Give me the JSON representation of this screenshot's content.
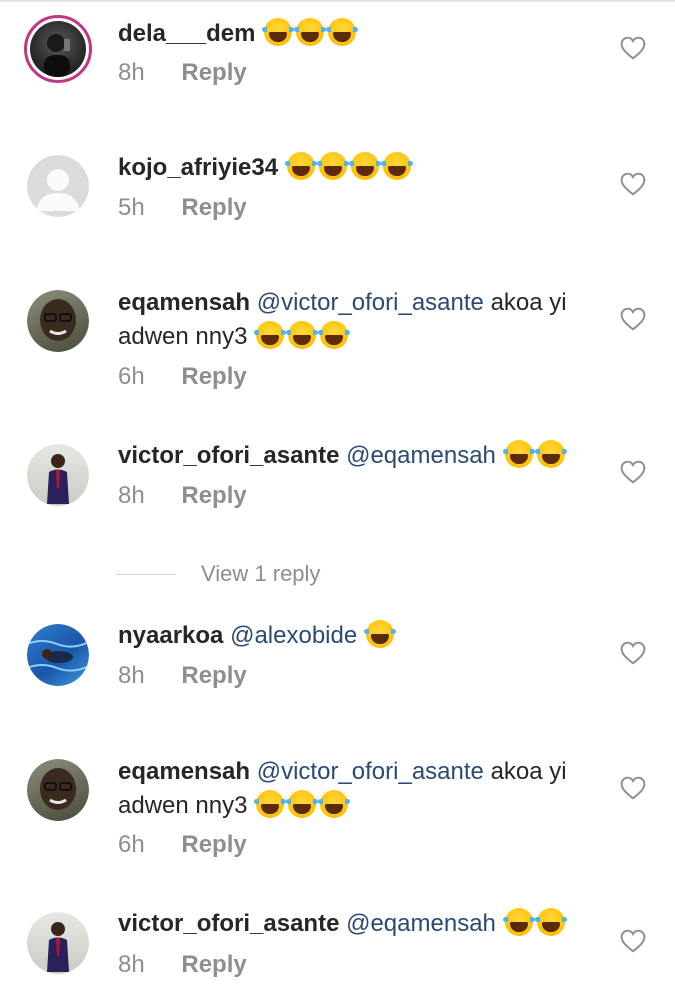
{
  "comments": [
    {
      "username": "dela___dem",
      "text": "",
      "time": "8h",
      "reply": "Reply",
      "emoji_count": 3,
      "avatar": "dark-selfie-avatar"
    },
    {
      "username": "kojo_afriyie34",
      "text": "",
      "time": "5h",
      "reply": "Reply",
      "emoji_count": 4,
      "avatar": "default-avatar"
    },
    {
      "username": "eqamensah",
      "mention": "@victor_ofori_asante",
      "text_line1": "akoa yi",
      "text_line2": "adwen nny3",
      "time": "6h",
      "reply": "Reply",
      "emoji_count": 3,
      "avatar": "man-glasses-avatar"
    },
    {
      "username": "victor_ofori_asante",
      "mention": "@eqamensah",
      "time": "8h",
      "reply": "Reply",
      "emoji_count": 2,
      "avatar": "man-suit-avatar"
    },
    {
      "username": "nyaarkoa",
      "mention": "@alexobide",
      "time": "8h",
      "reply": "Reply",
      "emoji_count": 1,
      "avatar": "pool-avatar"
    },
    {
      "username": "eqamensah",
      "mention": "@victor_ofori_asante",
      "text_line1": "akoa yi",
      "text_line2": "adwen nny3",
      "time": "6h",
      "reply": "Reply",
      "emoji_count": 3,
      "avatar": "man-glasses-avatar"
    },
    {
      "username": "victor_ofori_asante",
      "mention": "@eqamensah",
      "time": "8h",
      "reply": "Reply",
      "emoji_count": 2,
      "avatar": "man-suit-avatar"
    }
  ],
  "view_replies": "View 1 reply",
  "icons": {
    "like": "heart-outline-icon",
    "emoji": "face-with-tears-of-joy-icon"
  },
  "colors": {
    "mention": "#2b4a73",
    "meta": "#8e8e8e",
    "story_ring": "#c13584"
  }
}
